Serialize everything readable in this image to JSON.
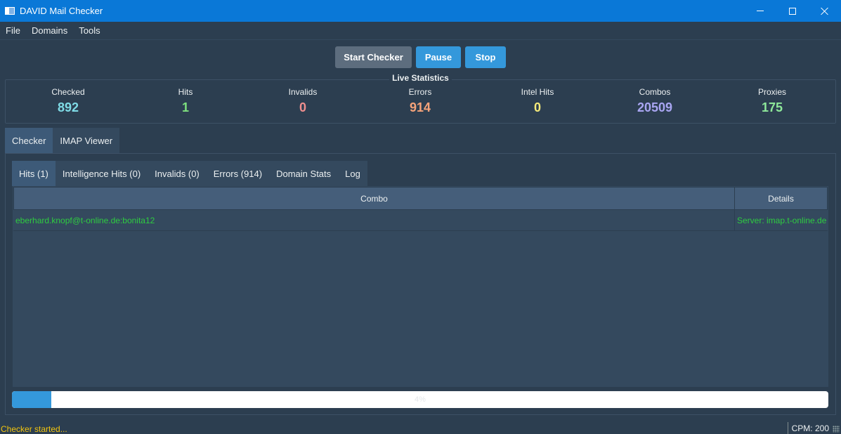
{
  "window": {
    "title": "DAVID Mail Checker"
  },
  "menu": {
    "file": "File",
    "domains": "Domains",
    "tools": "Tools"
  },
  "controls": {
    "start": "Start Checker",
    "pause": "Pause",
    "stop": "Stop"
  },
  "stats": {
    "title": "Live Statistics",
    "checked": {
      "label": "Checked",
      "value": "892",
      "color": "#7fdbe6"
    },
    "hits": {
      "label": "Hits",
      "value": "1",
      "color": "#7ee07e"
    },
    "invalids": {
      "label": "Invalids",
      "value": "0",
      "color": "#f08f8f"
    },
    "errors": {
      "label": "Errors",
      "value": "914",
      "color": "#f5a37a"
    },
    "intel_hits": {
      "label": "Intel Hits",
      "value": "0",
      "color": "#f5ea7a"
    },
    "combos": {
      "label": "Combos",
      "value": "20509",
      "color": "#a9a6f2"
    },
    "proxies": {
      "label": "Proxies",
      "value": "175",
      "color": "#8ee89a"
    }
  },
  "outer_tabs": [
    "Checker",
    "IMAP Viewer"
  ],
  "inner_tabs": [
    "Hits (1)",
    "Intelligence Hits (0)",
    "Invalids (0)",
    "Errors (914)",
    "Domain Stats",
    "Log"
  ],
  "table": {
    "columns": [
      "Combo",
      "Details"
    ],
    "rows": [
      {
        "combo": "eberhard.knopf@t-online.de:bonita12",
        "details": "Server: imap.t-online.de"
      }
    ]
  },
  "progress": {
    "value": 4,
    "text": "4%"
  },
  "status": {
    "message": "Checker started...",
    "cpm": "CPM: 200"
  },
  "colors": {
    "accent": "#3498db",
    "hit_text": "#2ecc40",
    "status_text": "#f1c40f"
  }
}
